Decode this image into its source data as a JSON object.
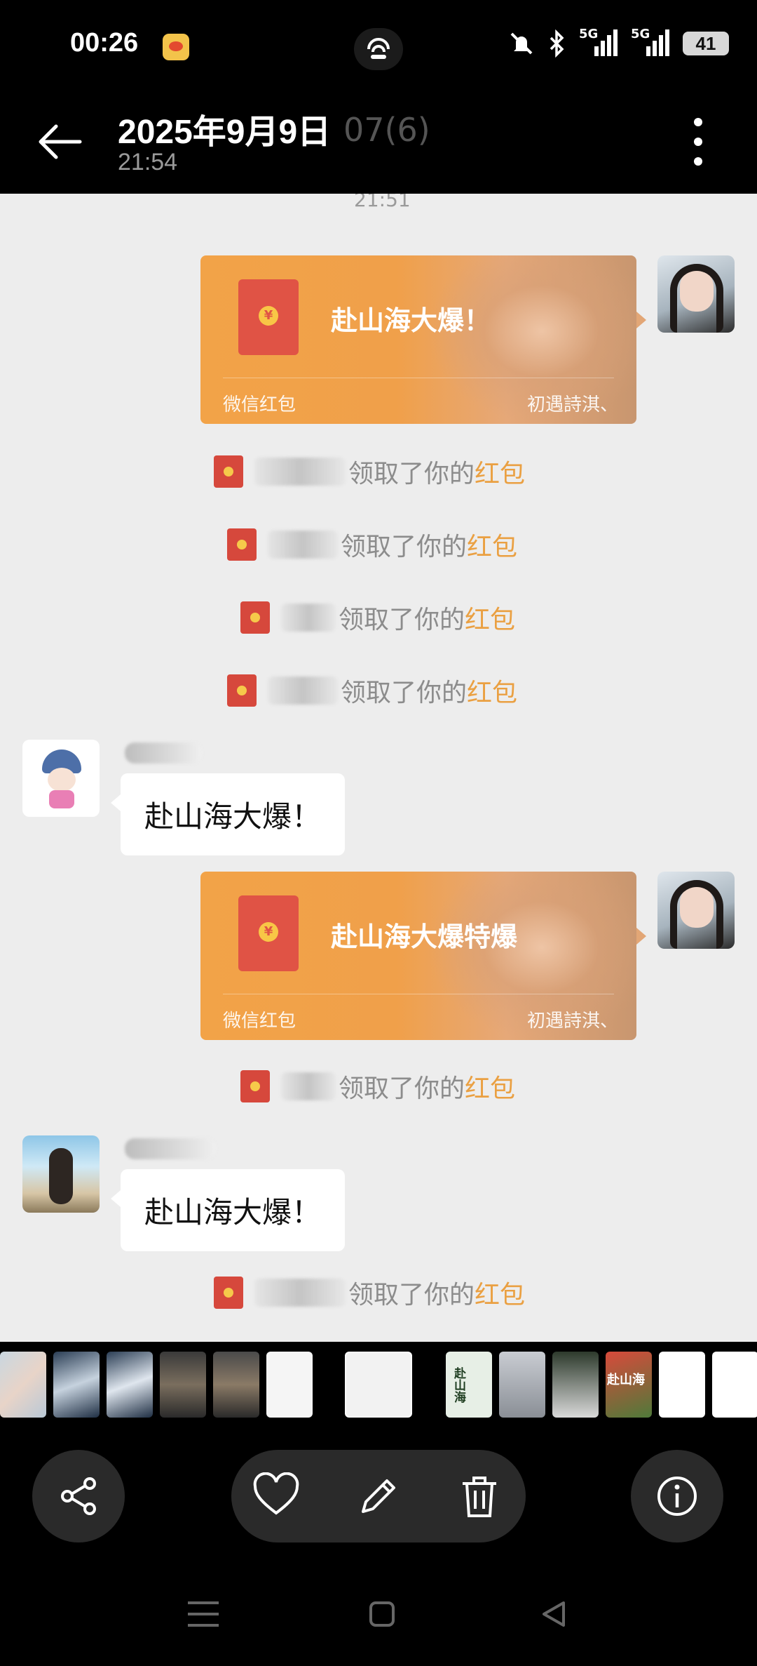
{
  "status_bar": {
    "time": "00:26",
    "battery": "41",
    "signal1": "5G",
    "signal2": "5G"
  },
  "header": {
    "title": "2025年9月9日",
    "subtitle": "21:54",
    "overlay_text": "07(6)"
  },
  "chat": {
    "overlay_time": "21:51",
    "messages": [
      {
        "type": "red_packet",
        "title": "赴山海大爆！",
        "label": "微信红包",
        "cover": "初遇詩淇、"
      },
      {
        "type": "notice",
        "text": "领取了你的",
        "link": "红包"
      },
      {
        "type": "notice",
        "text": "领取了你的",
        "link": "红包"
      },
      {
        "type": "notice",
        "text": "领取了你的",
        "link": "红包"
      },
      {
        "type": "notice",
        "text": "领取了你的",
        "link": "红包"
      },
      {
        "type": "text",
        "text": "赴山海大爆！"
      },
      {
        "type": "red_packet",
        "title": "赴山海大爆特爆",
        "label": "微信红包",
        "cover": "初遇詩淇、"
      },
      {
        "type": "notice",
        "text": "领取了你的",
        "link": "红包"
      },
      {
        "type": "text",
        "text": "赴山海大爆！"
      },
      {
        "type": "notice",
        "text": "领取了你的",
        "link": "红包"
      }
    ]
  },
  "thumbnails": {
    "thumb_text_1": "赴山海",
    "thumb_text_2": "赴山海"
  },
  "toolbar": {
    "share": "share-icon",
    "favorite": "heart-icon",
    "edit": "pencil-icon",
    "delete": "trash-icon",
    "info": "info-icon"
  },
  "colors": {
    "chat_bg": "#ededed",
    "red_packet": "#f2a348",
    "highlight": "#eaa042"
  }
}
